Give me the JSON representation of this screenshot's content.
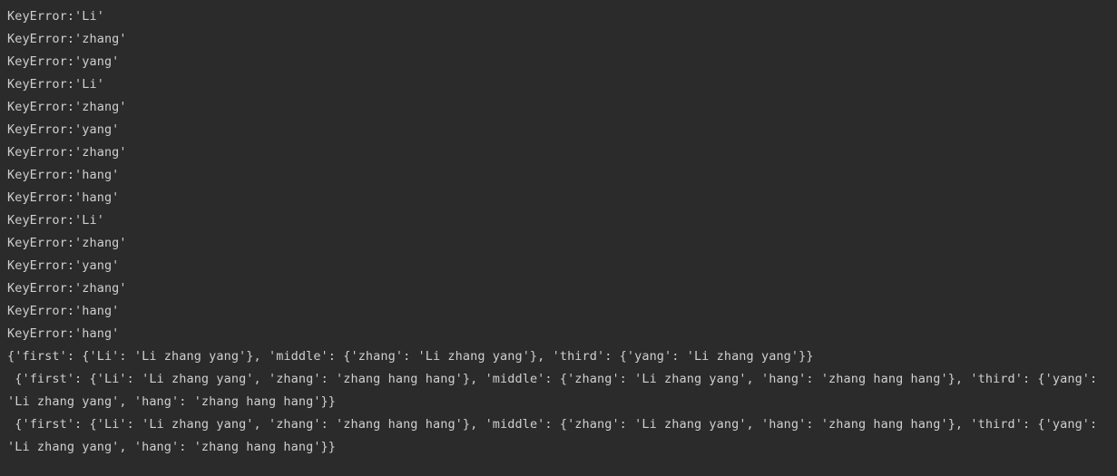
{
  "console": {
    "background_color": "#2b2b2b",
    "text_color": "#cfcfcf",
    "lines": [
      {
        "text": "KeyError:'Li'",
        "kind": "error"
      },
      {
        "text": "KeyError:'zhang'",
        "kind": "error"
      },
      {
        "text": "KeyError:'yang'",
        "kind": "error"
      },
      {
        "text": "KeyError:'Li'",
        "kind": "error"
      },
      {
        "text": "KeyError:'zhang'",
        "kind": "error"
      },
      {
        "text": "KeyError:'yang'",
        "kind": "error"
      },
      {
        "text": "KeyError:'zhang'",
        "kind": "error"
      },
      {
        "text": "KeyError:'hang'",
        "kind": "error"
      },
      {
        "text": "KeyError:'hang'",
        "kind": "error"
      },
      {
        "text": "KeyError:'Li'",
        "kind": "error"
      },
      {
        "text": "KeyError:'zhang'",
        "kind": "error"
      },
      {
        "text": "KeyError:'yang'",
        "kind": "error"
      },
      {
        "text": "KeyError:'zhang'",
        "kind": "error"
      },
      {
        "text": "KeyError:'hang'",
        "kind": "error"
      },
      {
        "text": "KeyError:'hang'",
        "kind": "error"
      },
      {
        "text": "{'first': {'Li': 'Li zhang yang'}, 'middle': {'zhang': 'Li zhang yang'}, 'third': {'yang': 'Li zhang yang'}}",
        "kind": "dict"
      },
      {
        "text": " {'first': {'Li': 'Li zhang yang', 'zhang': 'zhang hang hang'}, 'middle': {'zhang': 'Li zhang yang', 'hang': 'zhang hang hang'}, 'third': {'yang': 'Li zhang yang', 'hang': 'zhang hang hang'}}",
        "kind": "dict-wrapped"
      },
      {
        "text": " {'first': {'Li': 'Li zhang yang', 'zhang': 'zhang hang hang'}, 'middle': {'zhang': 'Li zhang yang', 'hang': 'zhang hang hang'}, 'third': {'yang': 'Li zhang yang', 'hang': 'zhang hang hang'}}",
        "kind": "dict-wrapped"
      }
    ]
  }
}
